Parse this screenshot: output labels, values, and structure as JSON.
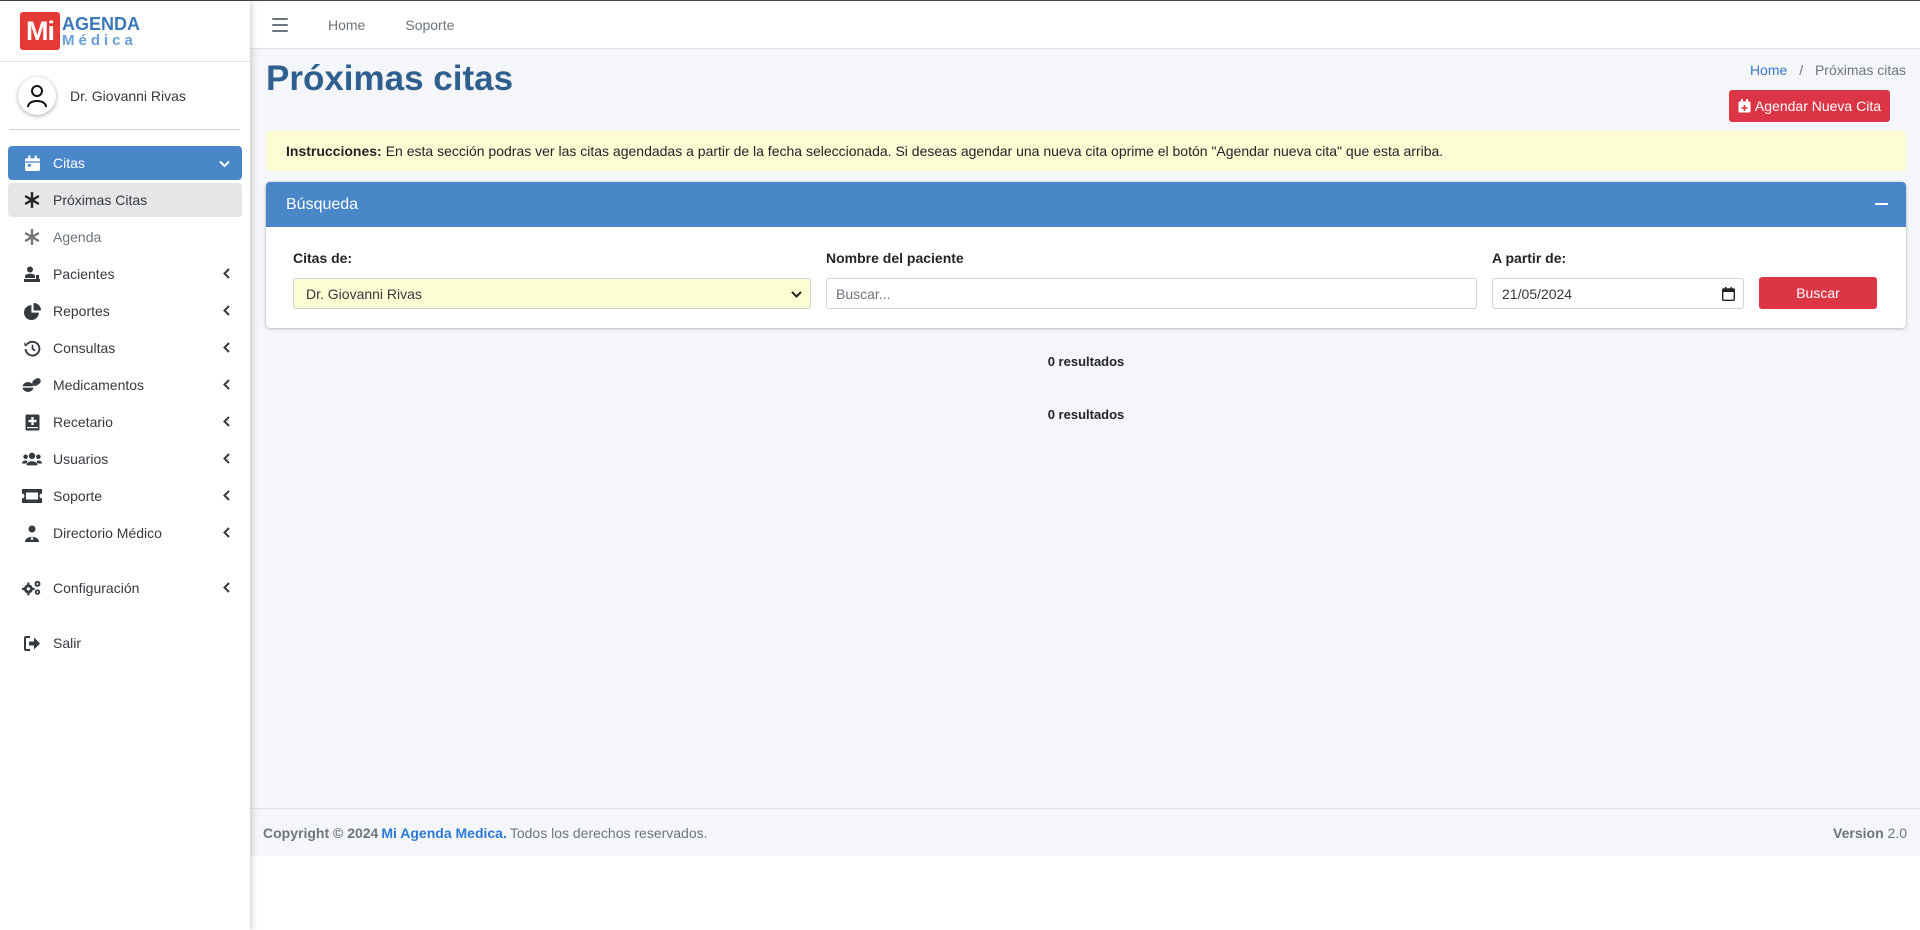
{
  "brand": {
    "mi": "Mi",
    "agenda": "AGENDA",
    "medica": "Médica"
  },
  "user": {
    "name": "Dr. Giovanni Rivas"
  },
  "sidebar": {
    "items": [
      {
        "label": "Citas",
        "icon": "calendar-icon"
      },
      {
        "label": "Próximas Citas",
        "icon": "asterisk-icon"
      },
      {
        "label": "Agenda",
        "icon": "asterisk-icon"
      },
      {
        "label": "Pacientes",
        "icon": "patient-icon"
      },
      {
        "label": "Reportes",
        "icon": "pie-chart-icon"
      },
      {
        "label": "Consultas",
        "icon": "history-icon"
      },
      {
        "label": "Medicamentos",
        "icon": "pills-icon"
      },
      {
        "label": "Recetario",
        "icon": "medical-book-icon"
      },
      {
        "label": "Usuarios",
        "icon": "users-icon"
      },
      {
        "label": "Soporte",
        "icon": "ticket-icon"
      },
      {
        "label": "Directorio Médico",
        "icon": "doctor-icon"
      },
      {
        "label": "Configuración",
        "icon": "gears-icon"
      },
      {
        "label": "Salir",
        "icon": "sign-out-icon"
      }
    ]
  },
  "topbar": {
    "home": "Home",
    "soporte": "Soporte"
  },
  "page": {
    "title": "Próximas citas",
    "breadcrumb_home": "Home",
    "breadcrumb_sep": "/",
    "breadcrumb_current": "Próximas citas",
    "new_button": "Agendar Nueva Cita"
  },
  "alert": {
    "label": "Instrucciones:",
    "text": "En esta sección podras ver las citas agendadas a partir de la fecha seleccionada. Si deseas agendar una nueva cita oprime el botón \"Agendar nueva cita\" que esta arriba."
  },
  "search": {
    "title": "Búsqueda",
    "citas_label": "Citas de:",
    "citas_value": "Dr. Giovanni Rivas",
    "patient_label": "Nombre del paciente",
    "patient_placeholder": "Buscar...",
    "date_label": "A partir de:",
    "date_value": "21/05/2024",
    "button": "Buscar"
  },
  "results": {
    "first": "0 resultados",
    "second": "0 resultados"
  },
  "footer": {
    "copyright": "Copyright © 2024",
    "app_name": "Mi Agenda Medica.",
    "rights": "Todos los derechos reservados.",
    "version_label": "Version",
    "version_value": "2.0"
  },
  "colors": {
    "primary": "#4a87c8",
    "danger": "#dc3545",
    "title": "#2f5f8f",
    "alert_bg": "#fdfdd4"
  }
}
